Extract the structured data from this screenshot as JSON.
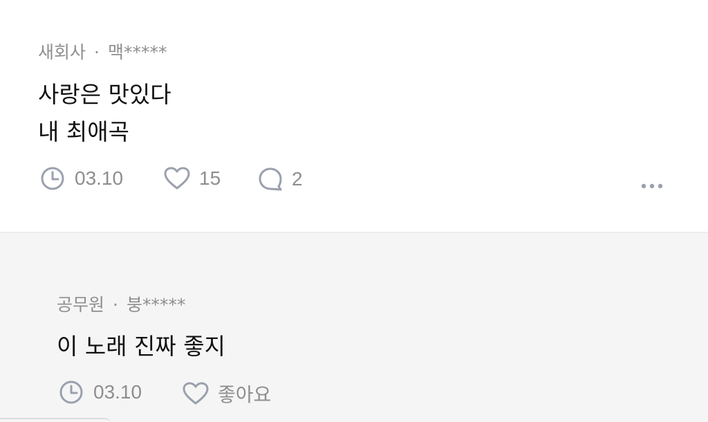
{
  "comment": {
    "company": "새회사",
    "separator": "·",
    "author": "맥*****",
    "lines": [
      "사랑은 맛있다",
      "내 최애곡"
    ],
    "date": "03.10",
    "likes": "15",
    "replies": "2"
  },
  "reply": {
    "company": "공무원",
    "separator": "·",
    "author": "붕*****",
    "lines": [
      "이 노래 진짜 좋지"
    ],
    "date": "03.10",
    "like_label": "좋아요"
  },
  "colors": {
    "meta": "#8e8e8e",
    "text": "#111111",
    "reply_bg": "#f5f5f5",
    "icon": "#9aa0ad"
  },
  "icons": [
    "clock-icon",
    "heart-icon",
    "chat-bubble-icon",
    "more-options-icon"
  ]
}
